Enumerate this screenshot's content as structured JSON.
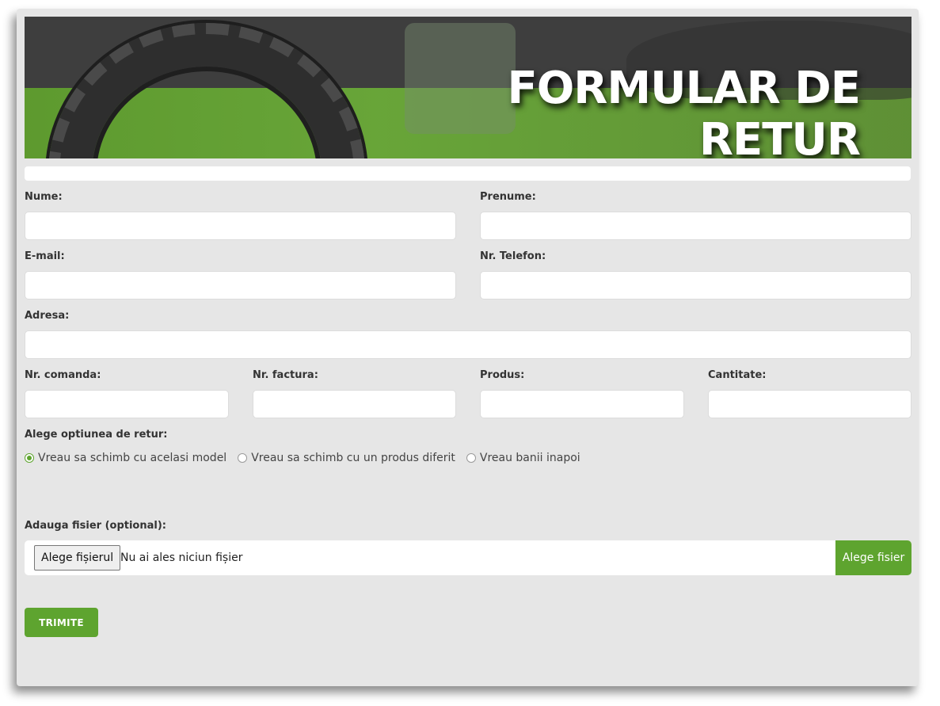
{
  "banner": {
    "title": "FORMULAR DE RETUR"
  },
  "fields": {
    "nume": "Nume:",
    "prenume": "Prenume:",
    "email": "E-mail:",
    "telefon": "Nr. Telefon:",
    "adresa": "Adresa:",
    "comanda": "Nr. comanda:",
    "factura": "Nr. factura:",
    "produs": "Produs:",
    "cantitate": "Cantitate:"
  },
  "return_option": {
    "label": "Alege optiunea de retur:",
    "options": [
      "Vreau sa schimb cu acelasi model",
      "Vreau sa schimb cu un produs diferit",
      "Vreau banii inapoi"
    ],
    "selected_index": 0
  },
  "upload": {
    "label": "Adauga fisier (optional):",
    "choose_label": "Alege fișierul",
    "no_file_text": "Nu ai ales niciun fișier",
    "button_label": "Alege fisier"
  },
  "submit_label": "TRIMITE",
  "colors": {
    "accent": "#5ea42f",
    "background": "#e6e6e6"
  }
}
